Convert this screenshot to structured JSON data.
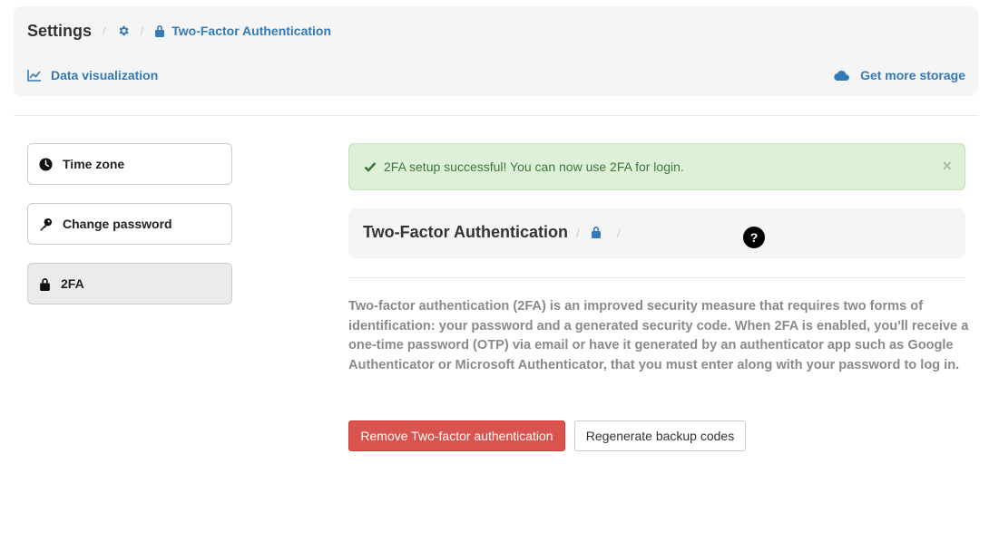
{
  "header": {
    "title": "Settings",
    "breadcrumb_current": "Two-Factor Authentication",
    "data_visualization_label": "Data visualization",
    "get_storage_label": "Get more storage",
    "breadcrumb_separator": "/",
    "link_color": "#337ab7"
  },
  "sidebar": {
    "items": [
      {
        "label": "Time zone",
        "icon": "clock-icon"
      },
      {
        "label": "Change password",
        "icon": "key-icon"
      },
      {
        "label": "2FA",
        "icon": "lock-icon",
        "active": true
      }
    ]
  },
  "alert": {
    "message": "2FA setup successful! You can now use 2FA for login.",
    "close_label": "×",
    "color": "#3c763d",
    "background": "#dff0d8"
  },
  "card": {
    "title": "Two-Factor Authentication",
    "separator": "/",
    "help_label": "?"
  },
  "description": "Two-factor authentication (2FA) is an improved security measure that requires two forms of identification: your password and a generated security code. When 2FA is enabled, you'll receive a one-time password (OTP) via email or have it generated by an authenticator app such as Google Authenticator or Microsoft Authenticator, that you must enter along with your password to log in.",
  "actions": {
    "remove_label": "Remove Two-factor authentication",
    "regenerate_label": "Regenerate backup codes",
    "danger_color": "#d9534f"
  }
}
